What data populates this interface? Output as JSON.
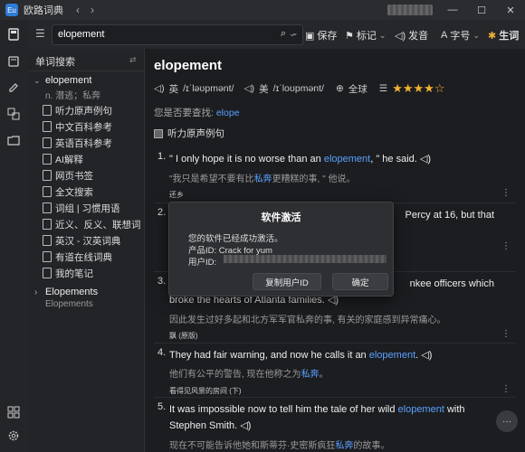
{
  "app": {
    "logo_text": "Eu",
    "title": "欧路词典"
  },
  "titlebar": {
    "back": "‹",
    "forward": "›",
    "minimize": "—",
    "maximize": "☐",
    "close": "✕"
  },
  "toolbar": {
    "search_value": "elopement",
    "save_label": "保存",
    "tag_label": "标记",
    "pronounce_label": "发音",
    "fontsize_label": "字号",
    "vocab_label": "生词"
  },
  "sidebar": {
    "header": "单词搜索",
    "entry_word": "elopement",
    "entry_def": "n. 潜逃；私奔",
    "sections": [
      "听力原声例句",
      "中文百科参考",
      "英语百科参考",
      "AI解释",
      "网页书签",
      "全文搜索",
      "词组 | 习惯用语",
      "近义、反义、联想词",
      "英汉 - 汉英词典",
      "有道在线词典",
      "我的笔记"
    ],
    "entry2_word": "Elopements",
    "entry2_sub": "Elopements"
  },
  "main": {
    "headword": "elopement",
    "uk_label": "英",
    "uk_phon": "/ɪˈləʊpmənt/",
    "us_label": "美",
    "us_phon": "/ɪˈloʊpmənt/",
    "global_label": "全球",
    "rating": 4,
    "suggest_prefix": "您是否要查找:",
    "suggest_word": "elope",
    "section_label": "听力原声例句"
  },
  "examples": [
    {
      "num": "1.",
      "en_pre": "\" I only hope it is no worse than an ",
      "en_kw": "elopement",
      "en_post": ", \" he said.",
      "zh_pre": "\"我只是希望不要有比",
      "zh_kw": "私奔",
      "zh_post": "更糟糕的事, \" 他说。",
      "src": "还乡"
    },
    {
      "num": "2.",
      "en_tail": "Percy at 16, but that"
    },
    {
      "num": "3.",
      "en_tail": "nkee officers which",
      "en_line2": "broke the hearts of Atlanta families.",
      "zh_pre": "因此发生过好多起和北方军军官",
      "zh_kw": "私奔",
      "zh_post": "的事, 有关的家庭感到异常痛心。",
      "src": "飘 (原版)"
    },
    {
      "num": "4.",
      "en_pre": "They had fair warning, and now he calls it an ",
      "en_kw": "elopement",
      "en_post": ".",
      "zh_pre": "他们有公平的警告, 现在他称之为",
      "zh_kw": "私奔",
      "zh_post": "。",
      "src": "看得见风景的房间 (下)"
    },
    {
      "num": "5.",
      "en_pre": "It was impossible now to tell him the tale of her wild ",
      "en_kw": "elopement",
      "en_post": " with",
      "en_line2": "Stephen Smith.",
      "zh_pre": "现在不可能告诉他她和斯蒂芬·史密斯疯狂",
      "zh_kw": "私奔",
      "zh_post": "的故事。"
    }
  ],
  "dialog": {
    "title": "软件激活",
    "line1": "您的软件已经成功激活。",
    "product_label": "产品ID:",
    "product_value": "Crack for yum",
    "user_label": "用户ID:",
    "copy_button": "复制用户ID",
    "ok_button": "确定"
  },
  "colors": {
    "accent": "#5aa0ff",
    "star": "#f2b233",
    "bg": "#1c1d20"
  }
}
